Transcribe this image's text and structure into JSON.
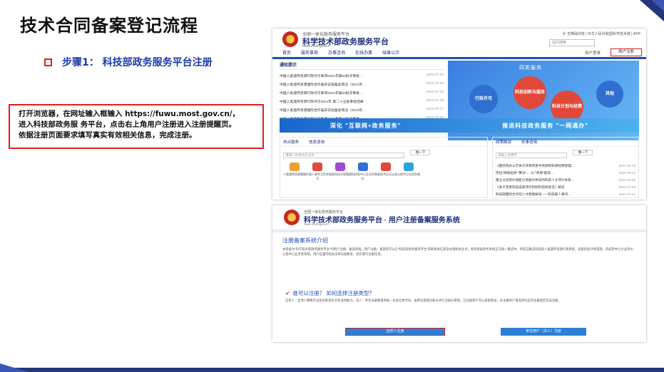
{
  "slide": {
    "title": "技术合同备案登记流程",
    "step": "步骤1：  科技部政务服务平台注册",
    "instructions": [
      "打开浏览器，在网址输入框输入 https://fuwu.most.gov.cn/，",
      "进入科技部政务服 务平台，点击右上角用户注册进入注册提醒页。",
      "依据注册页面要求填写真实有效相关信息，完成注册。"
    ]
  },
  "colors": {
    "accent_red": "#e0201d",
    "brand_blue": "#1a2e7a",
    "step_blue": "#1b3aa8"
  },
  "screenshot1": {
    "subtitle": "全国一体化政务服务平台",
    "site_title": "科学技术部政务服务平台",
    "url": "fuwu.most.gov.cn",
    "top_links": "▣ 无障碍浏览  |  中华人民共和国科学技术部  |  APP",
    "search_placeholder": "站内搜索",
    "login": "用户登录",
    "register": "用户注册",
    "nav": [
      "首页",
      "服务事项",
      "办事咨询",
      "在线办事",
      "结果公示"
    ],
    "notice_head": "通知提示",
    "notices": [
      {
        "text": "中国人类遗传资源行政许可事项2021年第50批次审批…",
        "date": "2021-07-30"
      },
      {
        "text": "中国人类遗传资源国际合作临床试验备案情况（2021年…",
        "date": "2021-07-30"
      },
      {
        "text": "中国人类遗传资源行政许可事项2021年第50批次审批…",
        "date": "2021-07-29"
      },
      {
        "text": "中国人类遗传资源行政许可2021年 第二十五批审批结果",
        "date": "2021-07-28"
      },
      {
        "text": "中国人类遗传资源国际合作临床试验备案情况（2021年…",
        "date": "2021-07-27"
      },
      {
        "text": "中国人类遗传资源行政许可事项2021年第49批次审批…",
        "date": "2021-07-26"
      }
    ],
    "banner_title": "四类服务",
    "banner_items": [
      "行政许可",
      "科技创新与服务",
      "科技计划与经费",
      "其他"
    ],
    "strip_left": "深化 \"互联网+政务服务\"",
    "strip_right": "推进科技政务服务 \"一网通办\"",
    "hot_head": "热点服务",
    "consult_head": "信息咨询",
    "hot_placeholder": "请输入您想办的业务…",
    "search_btn": "搜一下",
    "tiles": [
      "人类遗传资源管理",
      "外国人来华工作许可",
      "国家科技计划管理",
      "科技型中小企业评价",
      "高新技术企业认定",
      "火炬中心业务办理"
    ],
    "policy_head": "政策解读",
    "policy_consult": "办事咨询",
    "policy_placeholder": "请输入关键字…",
    "policies": [
      {
        "text": "《国务院办公厅关于改革完善中央财政科研经费管理…",
        "date": "2021-08-13"
      },
      {
        "text": "阿拉\"揭榜挂帅\"\"赛马\"… 以\"\"机制\"解读…",
        "date": "2021-08-11"
      },
      {
        "text": "建立以创新价值能力贡献为导向的科技人才评价体系…",
        "date": "2021-08-05"
      },
      {
        "text": "《关于完善科技成果评价机制的指导意见》解读",
        "date": "2021-07-26"
      },
      {
        "text": "科技部国际合作司人才政策解读——科技部人事司…",
        "date": "2021-07-21"
      }
    ]
  },
  "screenshot2": {
    "subtitle": "全国一体化政务服务平台",
    "site_title": "科学技术部政务服务平台 · 用户注册备案服务系统",
    "url": "fuwu.most.gov.cn",
    "section_title": "注册备案系统介绍",
    "intro": "本系统为\"科学技术部政务服务平台\"的用户注册、备案系统。用户注册、备案后可以在\"科技部政务服务平台\"获取相关信息及办理相关业务。原有各级政务系统正在统一集成中，目前已集成科技部人类遗传资源行政审批、国家科技计划管理、科技型中小企业评价、火炬中心业务等系统。用户应遵守相关法律法规要求，如实填写注册信息。",
    "question": "谁可以注册？ 如何选择注册类型？",
    "answer": "自然人：自然人需要于出生后即具有全民选择能力。法人：单位注册需提供统一社会信用代码，由单位管理员账号进行注册与管理。已注册用户可以直接登录，未注册用户请选择对应的注册类型完成注册。",
    "btn_person": "自然人注册",
    "btn_org": "单位用户（法人）注册"
  }
}
